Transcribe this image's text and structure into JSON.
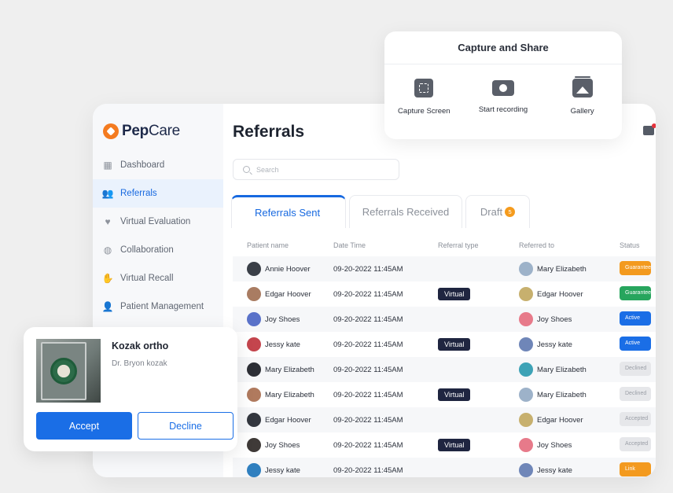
{
  "app": {
    "logo": {
      "bold": "Pep",
      "light": "Care"
    },
    "page_title": "Referrals",
    "search_placeholder": "Search",
    "sidebar": [
      {
        "label": "Dashboard",
        "icon": "grid-icon",
        "glyph": "▦",
        "active": false
      },
      {
        "label": "Referrals",
        "icon": "users-icon",
        "glyph": "👥",
        "active": true
      },
      {
        "label": "Virtual Evaluation",
        "icon": "heartbeat-icon",
        "glyph": "♥",
        "active": false
      },
      {
        "label": "Collaboration",
        "icon": "collaboration-icon",
        "glyph": "◍",
        "active": false
      },
      {
        "label": "Virtual Recall",
        "icon": "hand-icon",
        "glyph": "✋",
        "active": false
      },
      {
        "label": "Patient Management",
        "icon": "patient-icon",
        "glyph": "👤",
        "active": false
      }
    ],
    "tabs": {
      "sent": "Referrals Sent",
      "received": "Referrals Received",
      "draft": "Draft",
      "draft_count": "5"
    },
    "table": {
      "headers": [
        "Patient name",
        "Date Time",
        "Referral type",
        "Referred to",
        "Status"
      ],
      "rows": [
        {
          "patient": "Annie Hoover",
          "datetime": "09-20-2022 11:45AM",
          "type": "",
          "referred_to": "Mary Elizabeth",
          "status": "Guaranteed",
          "status_color": "#f39a1f",
          "avatar": "#3a3f47",
          "ref_avatar": "#9db2c9"
        },
        {
          "patient": "Edgar Hoover",
          "datetime": "09-20-2022 11:45AM",
          "type": "Virtual",
          "referred_to": "Edgar Hoover",
          "status": "Guaranteed",
          "status_color": "#27a55d",
          "avatar": "#a97c62",
          "ref_avatar": "#c7b06e"
        },
        {
          "patient": "Joy Shoes",
          "datetime": "09-20-2022 11:45AM",
          "type": "",
          "referred_to": "Joy Shoes",
          "status": "Active",
          "status_color": "#1a6ee6",
          "avatar": "#5a72c9",
          "ref_avatar": "#e77a8a"
        },
        {
          "patient": "Jessy kate",
          "datetime": "09-20-2022 11:45AM",
          "type": "Virtual",
          "referred_to": "Jessy kate",
          "status": "Active",
          "status_color": "#1a6ee6",
          "avatar": "#c4454d",
          "ref_avatar": "#6f86b8"
        },
        {
          "patient": "Mary Elizabeth",
          "datetime": "09-20-2022 11:45AM",
          "type": "",
          "referred_to": "Mary Elizabeth",
          "status": "Declined",
          "status_color": "#e6e7ea",
          "avatar": "#2d2f36",
          "ref_avatar": "#3da2b6"
        },
        {
          "patient": "Mary Elizabeth",
          "datetime": "09-20-2022 11:45AM",
          "type": "Virtual",
          "referred_to": "Mary Elizabeth",
          "status": "Declined",
          "status_color": "#e6e7ea",
          "avatar": "#b07a5e",
          "ref_avatar": "#9db2c9"
        },
        {
          "patient": "Edgar Hoover",
          "datetime": "09-20-2022 11:45AM",
          "type": "",
          "referred_to": "Edgar Hoover",
          "status": "Accepted",
          "status_color": "#e6e7ea",
          "avatar": "#33373f",
          "ref_avatar": "#c7b06e"
        },
        {
          "patient": "Joy Shoes",
          "datetime": "09-20-2022 11:45AM",
          "type": "Virtual",
          "referred_to": "Joy Shoes",
          "status": "Accepted",
          "status_color": "#e6e7ea",
          "avatar": "#3f3a38",
          "ref_avatar": "#e77a8a"
        },
        {
          "patient": "Jessy kate",
          "datetime": "09-20-2022 11:45AM",
          "type": "",
          "referred_to": "Jessy kate",
          "status": "Link",
          "status_color": "#f39a1f",
          "avatar": "#2f7fbf",
          "ref_avatar": "#6f86b8"
        }
      ]
    }
  },
  "capture": {
    "title": "Capture and Share",
    "options": [
      {
        "label": "Capture Screen",
        "icon": "capture-screen-icon"
      },
      {
        "label": "Start recording",
        "icon": "record-icon"
      },
      {
        "label": "Gallery",
        "icon": "gallery-icon"
      }
    ]
  },
  "referral_card": {
    "name": "Kozak ortho",
    "doctor": "Dr. Bryon kozak",
    "accept_label": "Accept",
    "decline_label": "Decline"
  }
}
